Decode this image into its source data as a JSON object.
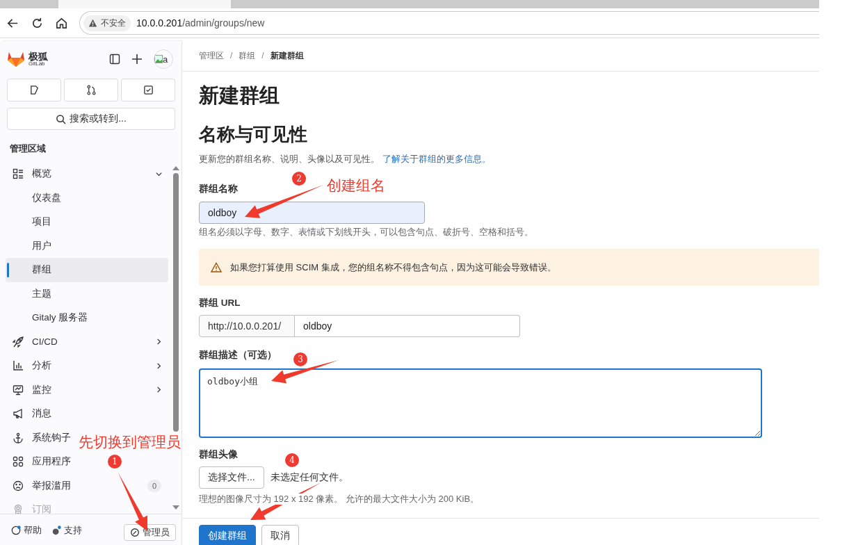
{
  "browser": {
    "security_label": "不安全",
    "url_host": "10.0.0.201",
    "url_path": "/admin/groups/new"
  },
  "sidebar": {
    "brand": {
      "name": "极狐",
      "sub": "GitLab"
    },
    "avatar_alt": "a",
    "search": {
      "placeholder": "搜索或转到..."
    },
    "section_title": "管理区域",
    "items": [
      {
        "label": "概览",
        "expanded": true,
        "children": [
          {
            "label": "仪表盘",
            "selected": false
          },
          {
            "label": "项目",
            "selected": false
          },
          {
            "label": "用户",
            "selected": false
          },
          {
            "label": "群组",
            "selected": true
          },
          {
            "label": "主题",
            "selected": false
          },
          {
            "label": "Gitaly 服务器",
            "selected": false
          }
        ]
      },
      {
        "label": "CI/CD",
        "expanded": false
      },
      {
        "label": "分析",
        "expanded": false
      },
      {
        "label": "监控",
        "expanded": false
      },
      {
        "label": "消息"
      },
      {
        "label": "系统钩子"
      },
      {
        "label": "应用程序"
      },
      {
        "label": "举报滥用",
        "badge": "0"
      },
      {
        "label": "订阅",
        "disabled": true
      }
    ],
    "footer": {
      "help": "帮助",
      "support": "支持",
      "admin": "管理员"
    }
  },
  "breadcrumbs": [
    {
      "label": "管理区"
    },
    {
      "separator": "/",
      "label": "群组"
    },
    {
      "separator": "/",
      "label": "新建群组"
    }
  ],
  "title": "新建群组",
  "section": {
    "title": "名称与可见性",
    "description": "更新您的群组名称、说明、头像以及可见性。",
    "link": "了解关于群组的更多信息。"
  },
  "name_field": {
    "label": "群组名称",
    "value": "oldboy",
    "hint": "组名必须以字母、数字、表情或下划线开头，可以包含句点、破折号、空格和括号。"
  },
  "alert": {
    "text": "如果您打算使用 SCIM 集成，您的组名称不得包含句点，因为这可能会导致错误。"
  },
  "url_field": {
    "label": "群组 URL",
    "prefix": "http://10.0.0.201/",
    "value": "oldboy"
  },
  "description_field": {
    "label": "群组描述（可选）",
    "value": "oldboy小组"
  },
  "avatar_field": {
    "label": "群组头像",
    "button": "选择文件...",
    "file_status": "未选定任何文件。",
    "hint": "理想的图像尺寸为 192 x 192 像素。 允许的最大文件大小为 200 KiB。"
  },
  "actions": {
    "submit": "创建群组",
    "cancel": "取消"
  },
  "annotations": [
    {
      "number": "1",
      "note": "先切换到管理员"
    },
    {
      "number": "2",
      "note": "创建组名"
    },
    {
      "number": "3"
    },
    {
      "number": "4"
    }
  ]
}
